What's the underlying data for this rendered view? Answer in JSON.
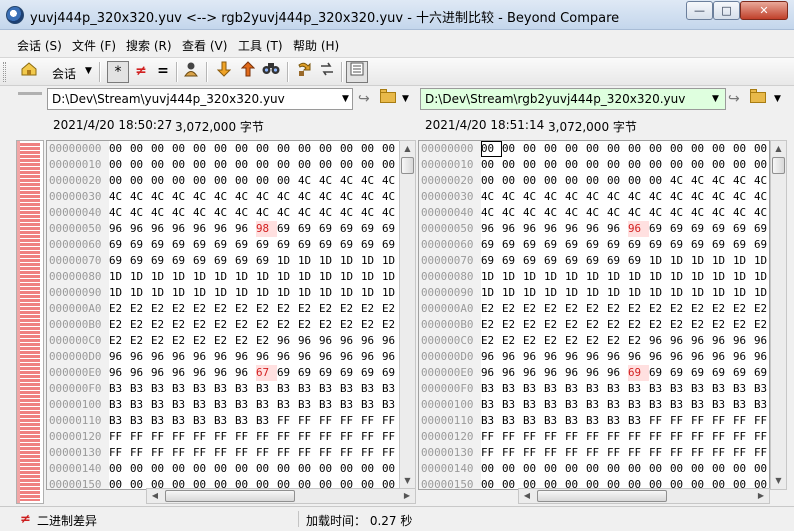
{
  "window": {
    "title": "yuvj444p_320x320.yuv <--> rgb2yuvj444p_320x320.yuv - 十六进制比较 - Beyond Compare",
    "minimize": "—",
    "maximize": "□",
    "close": "✕"
  },
  "menu": [
    "会话 (S)",
    "文件 (F)",
    "搜索 (R)",
    "查看 (V)",
    "工具 (T)",
    "帮助 (H)"
  ],
  "toolbar": {
    "session_label": "会话",
    "all_filter": "*",
    "diff_filter": "≠",
    "same_filter": "=",
    "icons": [
      "home-icon",
      "caret-down-icon",
      "asterisk-icon",
      "not-equal-icon",
      "equal-icon",
      "person-icon",
      "next-diff-icon",
      "prev-diff-icon",
      "binoculars-icon",
      "swap-icon",
      "swap-sides-icon",
      "details-icon"
    ]
  },
  "left": {
    "path": "D:\\Dev\\Stream\\yuvj444p_320x320.yuv",
    "date": "2021/4/20 18:50:27",
    "size": "3,072,000 字节"
  },
  "right": {
    "path": "D:\\Dev\\Stream\\rgb2yuvj444p_320x320.yuv",
    "date": "2021/4/20 18:51:14",
    "size": "3,072,000 字节"
  },
  "hex": {
    "addresses": [
      "00000000",
      "00000010",
      "00000020",
      "00000030",
      "00000040",
      "00000050",
      "00000060",
      "00000070",
      "00000080",
      "00000090",
      "000000A0",
      "000000B0",
      "000000C0",
      "000000D0",
      "000000E0",
      "000000F0",
      "00000100",
      "00000110",
      "00000120",
      "00000130",
      "00000140",
      "00000150"
    ],
    "left_rows": [
      "00 00 00 00 00 00 00 00 00 00 00 00 00 00",
      "00 00 00 00 00 00 00 00 00 00 00 00 00 00",
      "00 00 00 00 00 00 00 00 00 4C 4C 4C 4C 4C",
      "4C 4C 4C 4C 4C 4C 4C 4C 4C 4C 4C 4C 4C 4C",
      "4C 4C 4C 4C 4C 4C 4C 4C 4C 4C 4C 4C 4C 4C",
      "96 96 96 96 96 96 96 98 69 69 69 69 69 69",
      "69 69 69 69 69 69 69 69 69 69 69 69 69 69",
      "69 69 69 69 69 69 69 69 1D 1D 1D 1D 1D 1D",
      "1D 1D 1D 1D 1D 1D 1D 1D 1D 1D 1D 1D 1D 1D",
      "1D 1D 1D 1D 1D 1D 1D 1D 1D 1D 1D 1D 1D 1D",
      "E2 E2 E2 E2 E2 E2 E2 E2 E2 E2 E2 E2 E2 E2",
      "E2 E2 E2 E2 E2 E2 E2 E2 E2 E2 E2 E2 E2 E2",
      "E2 E2 E2 E2 E2 E2 E2 E2 96 96 96 96 96 96",
      "96 96 96 96 96 96 96 96 96 96 96 96 96 96",
      "96 96 96 96 96 96 96 67 69 69 69 69 69 69",
      "B3 B3 B3 B3 B3 B3 B3 B3 B3 B3 B3 B3 B3 B3",
      "B3 B3 B3 B3 B3 B3 B3 B3 B3 B3 B3 B3 B3 B3",
      "B3 B3 B3 B3 B3 B3 B3 B3 FF FF FF FF FF FF",
      "FF FF FF FF FF FF FF FF FF FF FF FF FF FF",
      "FF FF FF FF FF FF FF FF FF FF FF FF FF FF",
      "00 00 00 00 00 00 00 00 00 00 00 00 00 00",
      "00 00 00 00 00 00 00 00 00 00 00 00 00 00"
    ],
    "right_rows": [
      "00 00 00 00 00 00 00 00 00 00 00 00 00 00",
      "00 00 00 00 00 00 00 00 00 00 00 00 00 00",
      "00 00 00 00 00 00 00 00 00 4C 4C 4C 4C 4C",
      "4C 4C 4C 4C 4C 4C 4C 4C 4C 4C 4C 4C 4C 4C",
      "4C 4C 4C 4C 4C 4C 4C 4C 4C 4C 4C 4C 4C 4C",
      "96 96 96 96 96 96 96 96 69 69 69 69 69 69",
      "69 69 69 69 69 69 69 69 69 69 69 69 69 69",
      "69 69 69 69 69 69 69 69 1D 1D 1D 1D 1D 1D",
      "1D 1D 1D 1D 1D 1D 1D 1D 1D 1D 1D 1D 1D 1D",
      "1D 1D 1D 1D 1D 1D 1D 1D 1D 1D 1D 1D 1D 1D",
      "E2 E2 E2 E2 E2 E2 E2 E2 E2 E2 E2 E2 E2 E2",
      "E2 E2 E2 E2 E2 E2 E2 E2 E2 E2 E2 E2 E2 E2",
      "E2 E2 E2 E2 E2 E2 E2 E2 96 96 96 96 96 96",
      "96 96 96 96 96 96 96 96 96 96 96 96 96 96",
      "96 96 96 96 96 96 96 69 69 69 69 69 69 69",
      "B3 B3 B3 B3 B3 B3 B3 B3 B3 B3 B3 B3 B3 B3",
      "B3 B3 B3 B3 B3 B3 B3 B3 B3 B3 B3 B3 B3 B3",
      "B3 B3 B3 B3 B3 B3 B3 B3 FF FF FF FF FF FF",
      "FF FF FF FF FF FF FF FF FF FF FF FF FF FF",
      "FF FF FF FF FF FF FF FF FF FF FF FF FF FF",
      "00 00 00 00 00 00 00 00 00 00 00 00 00 00",
      "00 00 00 00 00 00 00 00 00 00 00 00 00 00"
    ],
    "diff_cells": [
      [
        5,
        7
      ],
      [
        14,
        7
      ]
    ],
    "diff_color": "#d21f1f"
  },
  "status": {
    "mode": "二进制差异",
    "load_time": "加载时间： 0.27 秒"
  },
  "colors": {
    "diff_marker": "#ef8080",
    "right_path_bg": "#dfffdf"
  }
}
